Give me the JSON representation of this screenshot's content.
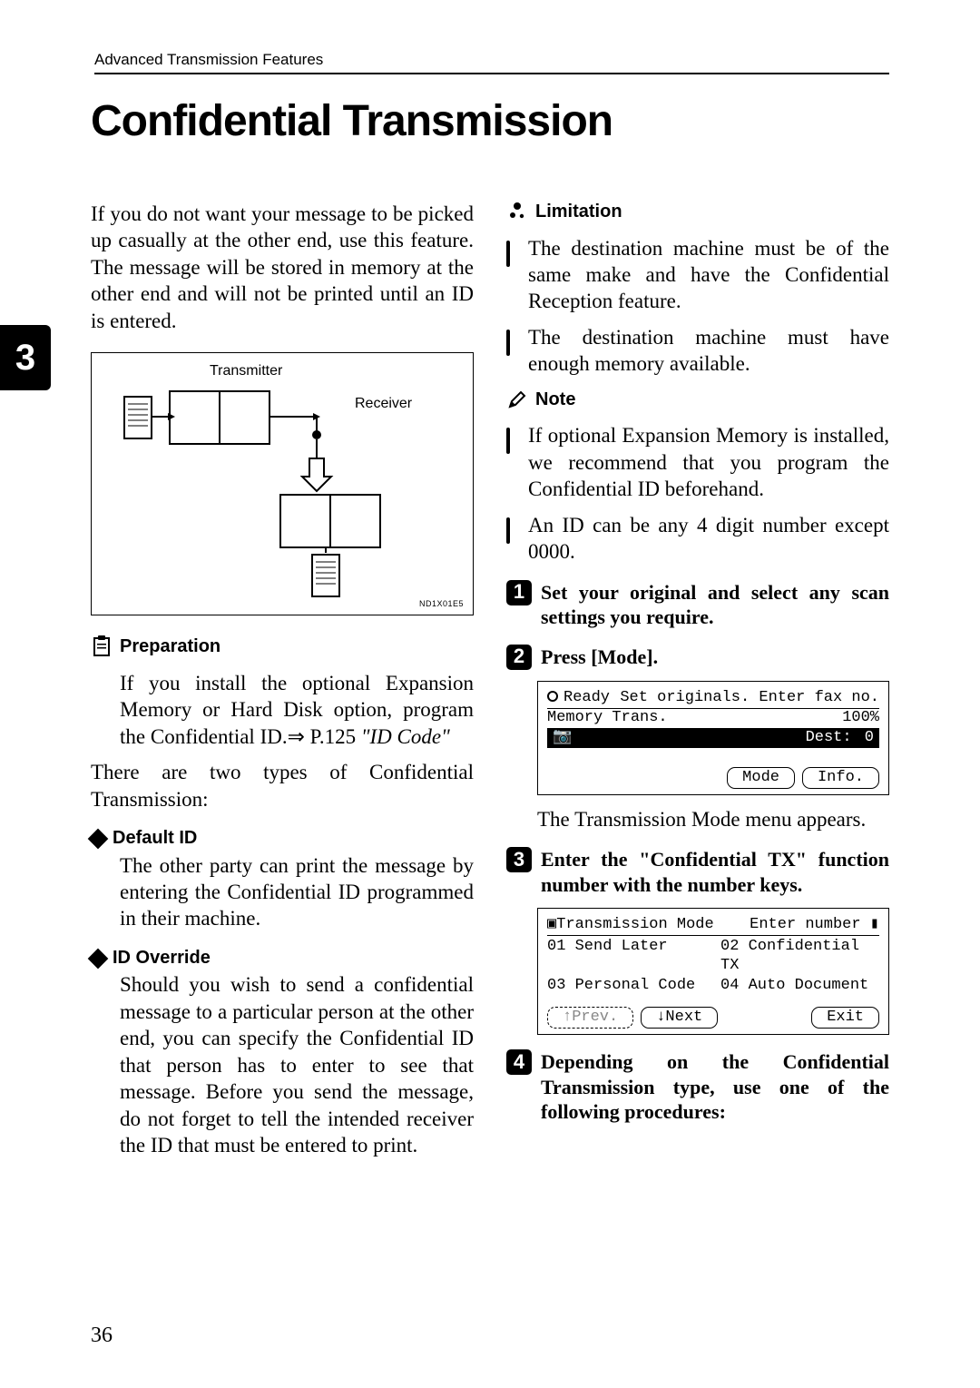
{
  "running_head": "Advanced Transmission Features",
  "section_tab": "3",
  "title": "Confidential Transmission",
  "intro": "If you do not want your message to be picked up casually at the other end, use this feature. The message will be stored in memory at the other end and will not be printed until an ID is entered.",
  "diagram": {
    "transmitter": "Transmitter",
    "receiver": "Receiver",
    "code": "ND1X01E5"
  },
  "preparation": {
    "label": "Preparation",
    "body": "If you install the optional Expansion Memory or Hard Disk option, program the Confidential ID.⇒ P.125 ",
    "ref": "\"ID Code\""
  },
  "types_intro": "There are two types of Confidential Transmission:",
  "default_id": {
    "label": "Default ID",
    "body": "The other party can print the message by entering the Confidential ID programmed in their machine."
  },
  "id_override": {
    "label": "ID Override",
    "body": "Should you wish to send a confidential message to a particular person at the other end, you can specify the Confidential ID that person has to enter to see that message. Before you send the message, do not forget to tell the intended receiver the ID that must be entered to print."
  },
  "limitation": {
    "label": "Limitation",
    "items": [
      "The destination machine must be of the same make and have the Confidential Reception feature.",
      "The destination machine must have enough memory available."
    ]
  },
  "note": {
    "label": "Note",
    "items": [
      "If optional Expansion Memory is installed, we recommend that you program the Confidential ID beforehand.",
      "An ID can be any 4 digit number except 0000."
    ]
  },
  "steps": {
    "s1": "Set your original and select any scan settings you require.",
    "s2_a": "Press ",
    "s2_key": "Mode",
    "s2_b": ".",
    "s2_after": "The Transmission Mode menu appears.",
    "s3": "Enter the \"Confidential TX\" function number with the number keys.",
    "s4": "Depending on the Confidential Transmission type, use one of the following procedures:"
  },
  "lcd1": {
    "ready": "Ready",
    "prompt": "Set originals. Enter fax no.",
    "memory_trans": "Memory Trans.",
    "pct": "100%",
    "dest": "Dest:",
    "dest_val": "0",
    "btn_mode": "Mode",
    "btn_info": "Info."
  },
  "lcd2": {
    "header_left": "Transmission Mode",
    "header_right": "Enter number",
    "opt1": "01 Send Later",
    "opt2": "02 Confidential TX",
    "opt3": "03 Personal Code",
    "opt4": "04 Auto Document",
    "btn_prev": "↑Prev.",
    "btn_next": "↓Next",
    "btn_exit": "Exit"
  },
  "page_number": "36"
}
